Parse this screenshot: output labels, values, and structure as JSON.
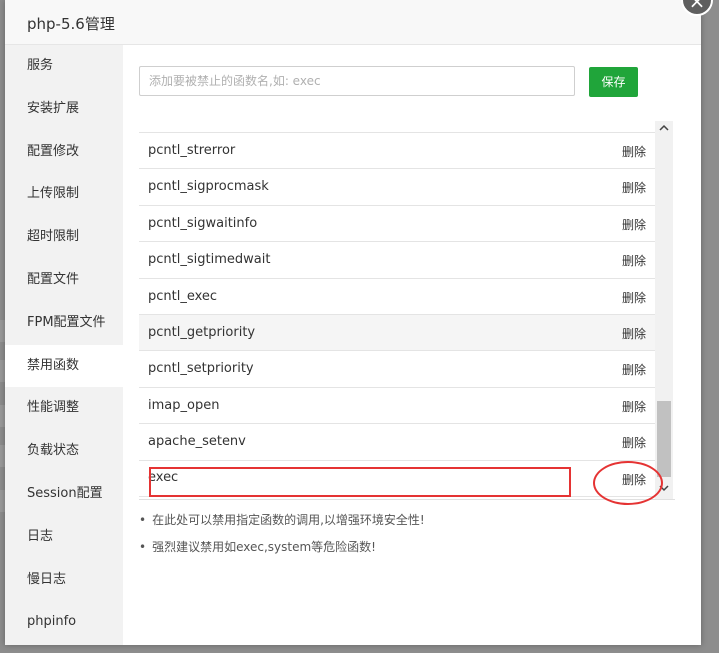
{
  "dialog": {
    "title": "php-5.6管理",
    "close_icon": "close-icon"
  },
  "sidebar": {
    "items": [
      {
        "label": "服务"
      },
      {
        "label": "安装扩展"
      },
      {
        "label": "配置修改"
      },
      {
        "label": "上传限制"
      },
      {
        "label": "超时限制"
      },
      {
        "label": "配置文件"
      },
      {
        "label": "FPM配置文件"
      },
      {
        "label": "禁用函数",
        "active": true
      },
      {
        "label": "性能调整"
      },
      {
        "label": "负载状态"
      },
      {
        "label": "Session配置"
      },
      {
        "label": "日志"
      },
      {
        "label": "慢日志"
      },
      {
        "label": "phpinfo"
      }
    ]
  },
  "disable_functions": {
    "input_placeholder": "添加要被禁止的函数名,如: exec",
    "save_label": "保存",
    "delete_label": "删除",
    "functions": [
      "pcntl_strerror",
      "pcntl_sigprocmask",
      "pcntl_sigwaitinfo",
      "pcntl_sigtimedwait",
      "pcntl_exec",
      "pcntl_getpriority",
      "pcntl_setpriority",
      "imap_open",
      "apache_setenv",
      "exec"
    ],
    "notes": [
      "在此处可以禁用指定函数的调用,以增强环境安全性!",
      "强烈建议禁用如exec,system等危险函数!"
    ]
  },
  "colors": {
    "accent": "#20a53a",
    "annotation": "#e53333"
  }
}
